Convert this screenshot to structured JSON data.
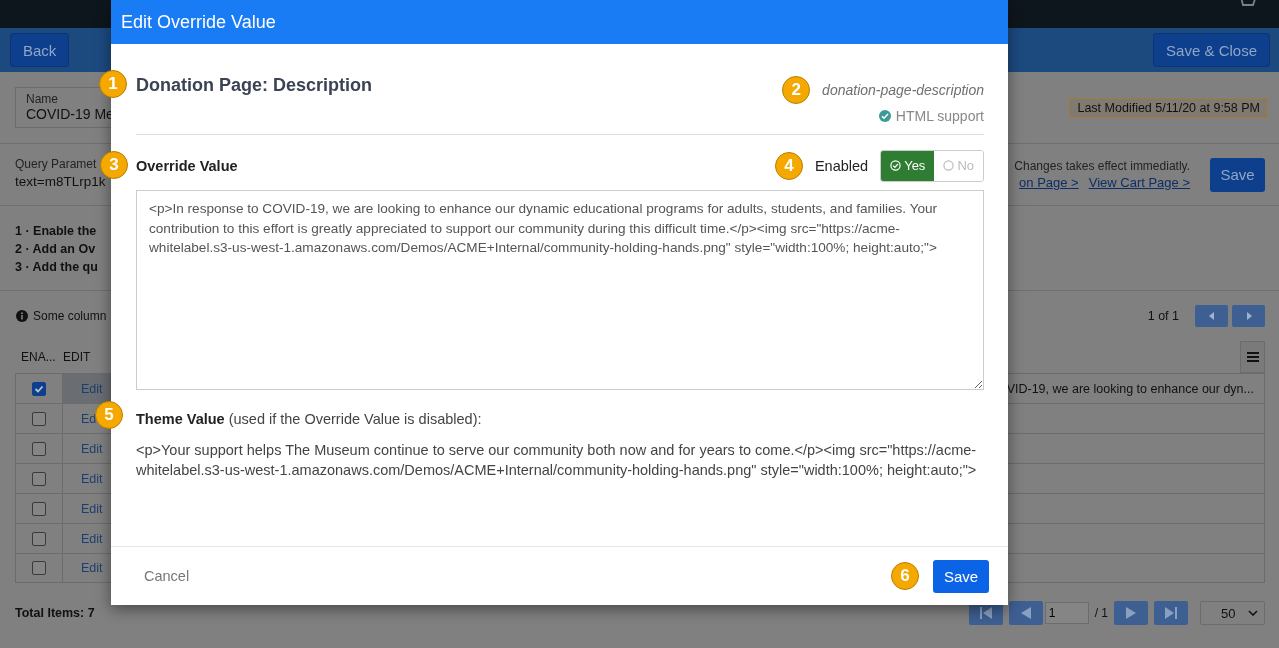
{
  "page": {
    "back": "Back",
    "save_close": "Save & Close",
    "name_label": "Name",
    "name_value": "COVID-19 Me",
    "last_modified": "Last Modified 5/11/20 at 9:58 PM",
    "query_label": "Query Paramet",
    "query_value": "text=m8TLrp1k",
    "notice": "Changes takes effect immediatly.",
    "links": [
      "on Page >",
      "View Cart Page >"
    ],
    "save": "Save",
    "steps": [
      "1 · Enable the",
      "2 · Add an Ov",
      "3 · Add the qu"
    ],
    "columns_note": "Some column",
    "page_count": "1 of 1",
    "table": {
      "columns": [
        "ENA...",
        "EDIT"
      ],
      "rows": [
        {
          "enabled": true,
          "edit": "Edit",
          "selected": true,
          "column_3": "VID-19, we are looking to enhance our dyn..."
        },
        {
          "enabled": false,
          "edit": "Ed",
          "selected": false
        },
        {
          "enabled": false,
          "edit": "Edit",
          "selected": false
        },
        {
          "enabled": false,
          "edit": "Edit",
          "selected": false
        },
        {
          "enabled": false,
          "edit": "Edit",
          "selected": false
        },
        {
          "enabled": false,
          "edit": "Edit",
          "selected": false
        },
        {
          "enabled": false,
          "edit": "Edit",
          "selected": false
        }
      ]
    },
    "total": "Total Items: 7",
    "pager": {
      "page": "1",
      "of": "/ 1",
      "per_page": "50"
    }
  },
  "modal": {
    "title": "Edit Override Value",
    "heading": "Donation Page: Description",
    "heading_badge": "1",
    "key": "donation-page-description",
    "key_badge": "2",
    "html_support": "HTML support",
    "override_label": "Override Value",
    "override_badge": "3",
    "enabled_label": "Enabled",
    "enabled_badge": "4",
    "toggle": [
      {
        "label": "Yes",
        "selected": true
      },
      {
        "label": "No",
        "selected": false
      }
    ],
    "override_value": "<p>In response to COVID-19, we are looking to enhance our dynamic educational programs for adults, students, and families. Your contribution to this effort is greatly appreciated to support our community during this difficult time.</p><img src=\"https://acme-whitelabel.s3-us-west-1.amazonaws.com/Demos/ACME+Internal/community-holding-hands.png\" style=\"width:100%; height:auto;\">",
    "theme_label": "**Theme Value** (used if the Override Value is disabled):",
    "theme_badge": "5",
    "theme_value": "<p>Your support helps The Museum continue to serve our community both now and for years to come.</p><img src=\"https://acme-whitelabel.s3-us-west-1.amazonaws.com/Demos/ACME+Internal/community-holding-hands.png\" style=\"width:100%; height:auto;\">",
    "cancel": "Cancel",
    "save": "Save",
    "save_badge": "6"
  }
}
